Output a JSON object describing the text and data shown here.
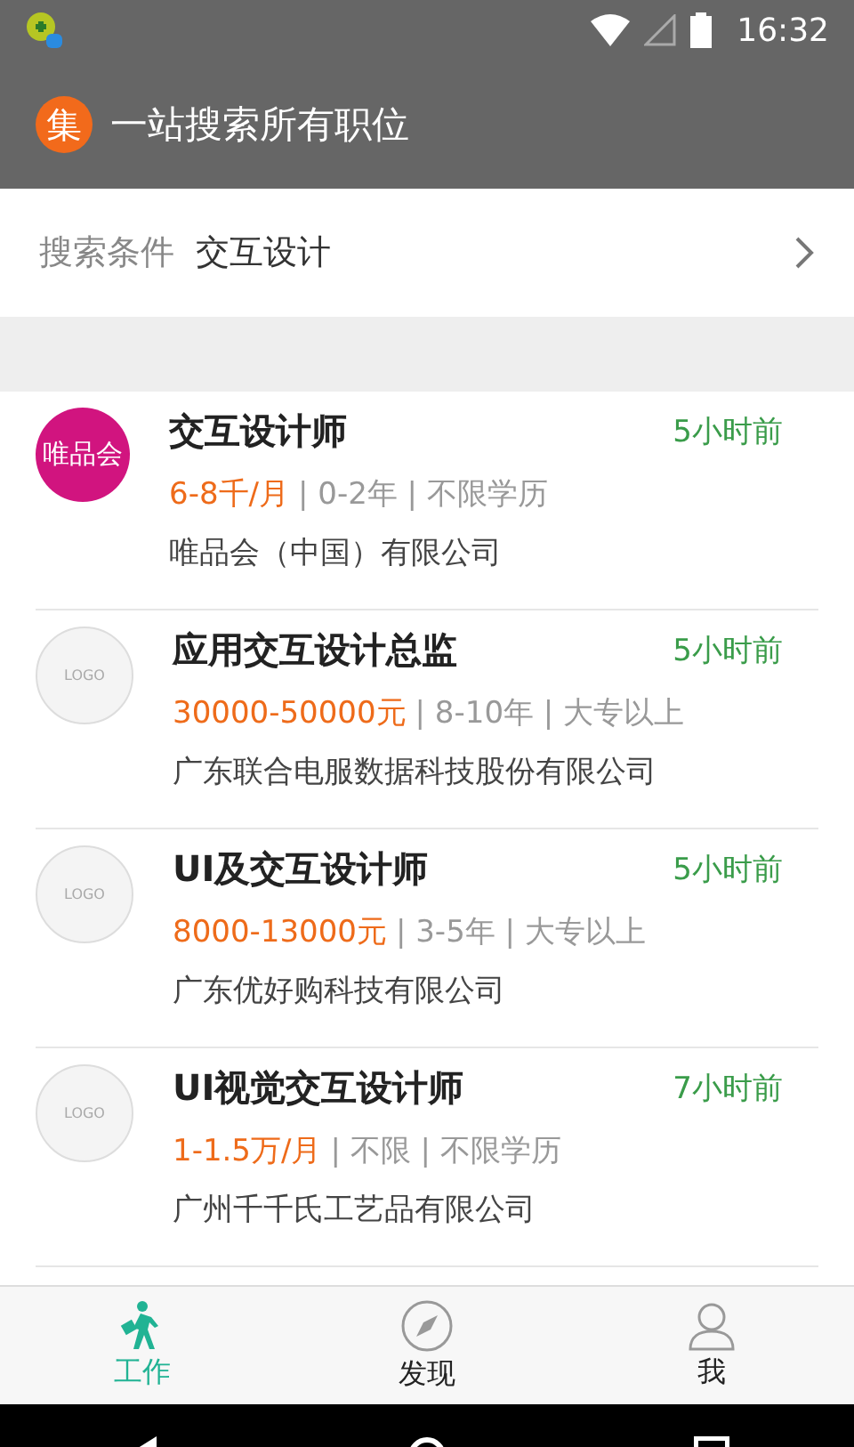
{
  "status_bar": {
    "time": "16:32"
  },
  "app_bar": {
    "logo": "集",
    "title": "一站搜索所有职位"
  },
  "search": {
    "label": "搜索条件",
    "value": "交互设计"
  },
  "jobs": [
    {
      "logo": {
        "kind": "brand",
        "text": "唯品会",
        "color": "#d1147f"
      },
      "title": "交互设计师",
      "time": "5小时前",
      "salary": "6-8千/月",
      "details": "| 0-2年 | 不限学历",
      "company": "唯品会（中国）有限公司"
    },
    {
      "logo": {
        "kind": "placeholder",
        "text": "LOGO"
      },
      "title": "应用交互设计总监",
      "time": "5小时前",
      "salary": "30000-50000元",
      "details": "| 8-10年 | 大专以上",
      "company": "广东联合电服数据科技股份有限公司"
    },
    {
      "logo": {
        "kind": "placeholder",
        "text": "LOGO"
      },
      "title": "UI及交互设计师",
      "time": "5小时前",
      "salary": "8000-13000元",
      "details": "| 3-5年 | 大专以上",
      "company": "广东优好购科技有限公司"
    },
    {
      "logo": {
        "kind": "placeholder",
        "text": "LOGO"
      },
      "title": "UI视觉交互设计师",
      "time": "7小时前",
      "salary": "1-1.5万/月",
      "details": "| 不限 | 不限学历",
      "company": "广州千千氏工艺品有限公司"
    }
  ],
  "tabs": [
    {
      "kind": "work",
      "label": "工作",
      "selected": true
    },
    {
      "kind": "discover",
      "label": "发现",
      "selected": false
    },
    {
      "kind": "me",
      "label": "我",
      "selected": false
    }
  ]
}
